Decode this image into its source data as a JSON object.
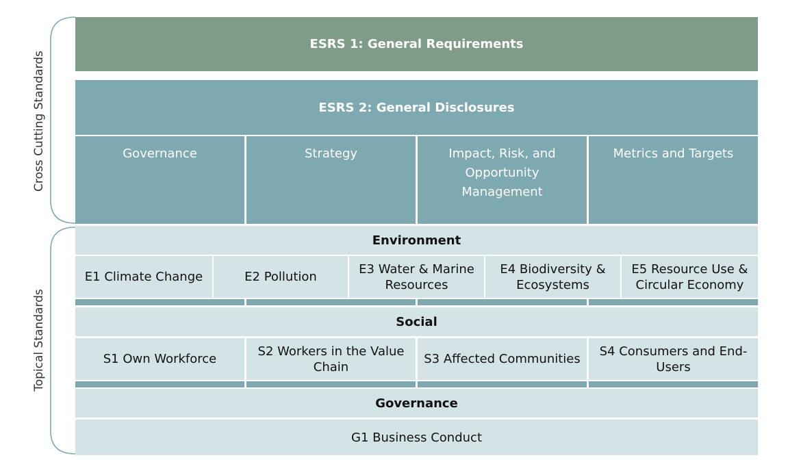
{
  "side_labels": {
    "cross_cutting": "Cross Cutting Standards",
    "topical": "Topical Standards"
  },
  "esrs1": "ESRS 1: General Requirements",
  "esrs2": {
    "title": "ESRS 2: General Disclosures",
    "columns": [
      "Governance",
      "Strategy",
      "Impact, Risk, and Opportunity Management",
      "Metrics and Targets"
    ]
  },
  "environment": {
    "title": "Environment",
    "items": [
      "E1 Climate Change",
      "E2 Pollution",
      "E3 Water & Marine Resources",
      "E4 Biodiversity & Ecosystems",
      "E5 Resource Use & Circular Economy"
    ]
  },
  "social": {
    "title": "Social",
    "items": [
      "S1 Own Workforce",
      "S2 Workers in the Value Chain",
      "S3 Affected Communities",
      "S4 Consumers and End-Users"
    ]
  },
  "governance": {
    "title": "Governance",
    "items": [
      "G1 Business Conduct"
    ]
  },
  "colors": {
    "esrs1": "#7f9c88",
    "esrs2": "#7ea9b1",
    "topical": "#d4e3e6"
  }
}
